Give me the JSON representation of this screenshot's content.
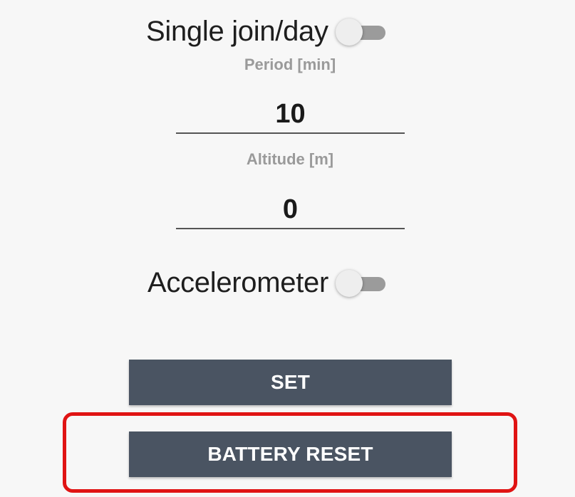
{
  "settings": {
    "single_join": {
      "label": "Single join/day",
      "enabled": false
    },
    "period": {
      "label": "Period [min]",
      "value": "10"
    },
    "altitude": {
      "label": "Altitude [m]",
      "value": "0"
    },
    "accelerometer": {
      "label": "Accelerometer",
      "enabled": false
    }
  },
  "buttons": {
    "set_label": "SET",
    "battery_reset_label": "BATTERY RESET"
  },
  "colors": {
    "button_bg": "#4a5462",
    "highlight": "#e01414",
    "switch_track": "#9b9b9b",
    "switch_thumb": "#eeeeee"
  }
}
